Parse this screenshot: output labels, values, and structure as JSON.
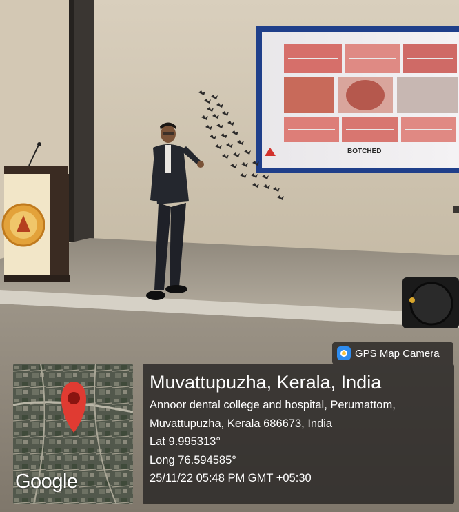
{
  "photo": {
    "slide_label": "BOTCHED"
  },
  "gps_overlay": {
    "app_label": "GPS Map Camera",
    "icon": "gps-map-camera-icon",
    "map_brand": "Google",
    "pin_icon": "map-pin-icon",
    "place_title": "Muvattupuzha, Kerala, India",
    "address_line_1": "Annoor dental college and hospital, Perumattom,",
    "address_line_2": "Muvattupuzha, Kerala 686673, India",
    "latitude": "Lat 9.995313°",
    "longitude": "Long 76.594585°",
    "timestamp": "25/11/22 05:48 PM GMT +05:30"
  }
}
